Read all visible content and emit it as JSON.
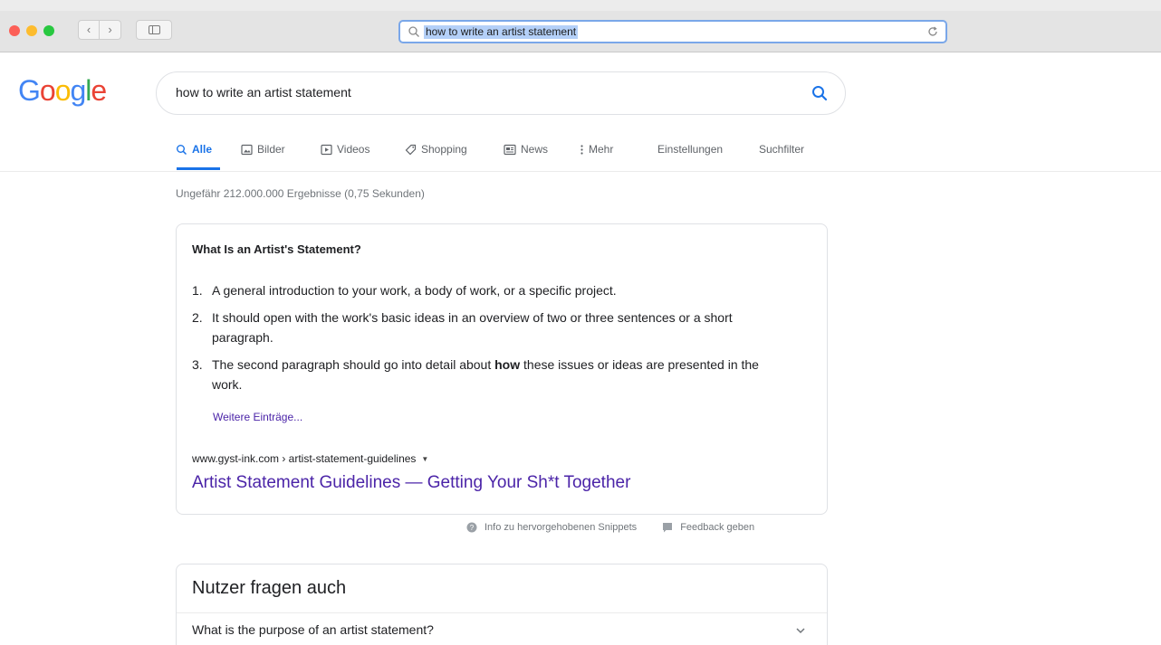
{
  "browser": {
    "address_text": "how to write an artist statement",
    "traffic_light_colors": {
      "close": "#fc5f57",
      "minimize": "#fdbc2e",
      "maximize": "#28c840"
    },
    "back_glyph": "‹",
    "forward_glyph": "›"
  },
  "logo": {
    "letters": [
      "G",
      "o",
      "o",
      "g",
      "l",
      "e"
    ],
    "colors": [
      "#4285f4",
      "#ea4335",
      "#fbbc05",
      "#4285f4",
      "#34a853",
      "#ea4335"
    ]
  },
  "search": {
    "query": "how to write an artist statement",
    "accent": "#1a73e8"
  },
  "tabs": {
    "all": "Alle",
    "images": "Bilder",
    "videos": "Videos",
    "shopping": "Shopping",
    "news": "News",
    "more": "Mehr",
    "settings": "Einstellungen",
    "tools": "Suchfilter"
  },
  "result_stats": "Ungefähr 212.000.000 Ergebnisse (0,75 Sekunden)",
  "snippet": {
    "title": "What Is an Artist's Statement?",
    "items": [
      {
        "num": "1.",
        "text": "A general introduction to your work, a body of work, or a specific project."
      },
      {
        "num": "2.",
        "text": "It should open with the work's basic ideas in an overview of two or three sentences or a short paragraph."
      },
      {
        "num": "3.",
        "text_before": "The second paragraph should go into detail about ",
        "bold": "how",
        "text_after": " these issues or ideas are presented in the work."
      }
    ],
    "more_link": "Weitere Einträge...",
    "cite": "www.gyst-ink.com › artist-statement-guidelines",
    "link_title": "Artist Statement Guidelines — Getting Your Sh*t Together",
    "link_color": "#4b24a8"
  },
  "snippet_footer": {
    "info": "Info zu hervorgehobenen Snippets",
    "feedback": "Feedback geben"
  },
  "people_also_ask": {
    "title": "Nutzer fragen auch",
    "questions": [
      "What is the purpose of an artist statement?"
    ]
  }
}
